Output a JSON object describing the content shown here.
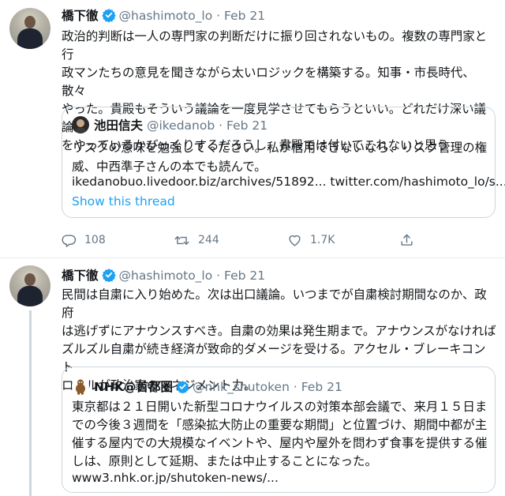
{
  "tweets": [
    {
      "name": "橋下徹",
      "handle": "@hashimoto_lo",
      "dot": "·",
      "date": "Feb 21",
      "lines": [
        "政治的判断は一人の専門家の判断だけに振り回されないもの。複数の専門家と行",
        "政マンたちの意見を聞きながら太いロジックを構築する。知事・市長時代、散々",
        "やった。貴殿もそういう議論を一度見学させてもらうといい。どれだけ深い議論",
        "をやっているかびっくりするだろうし、貴殿では付いてこれないと思う"
      ],
      "quote": {
        "name": "池田信夫",
        "handle": "@ikedanob",
        "dot": "·",
        "date": "Feb 21",
        "lines": [
          "リスクの意味を勉強してください。私が信用できないなら、リスク管理の権",
          "威、中西準子さんの本でも読んで。"
        ],
        "link": "ikedanobuo.livedoor.biz/archives/51892... twitter.com/hashimoto_lo/s...",
        "show_thread": "Show this thread"
      },
      "actions": {
        "replies": "108",
        "retweets": "244",
        "likes": "1.7K"
      }
    },
    {
      "name": "橋下徹",
      "handle": "@hashimoto_lo",
      "dot": "·",
      "date": "Feb 21",
      "lines": [
        "民間は自粛に入り始めた。次は出口議論。いつまでが自粛検討期間なのか、政府",
        "は逃げずにアナウンスすべき。自粛の効果は発生期まで。アナウンスがなければ",
        "ズルズル自粛が続き経済が致命的ダメージを受ける。アクセル・ブレーキコント",
        "ロールが政治家のマネジメント力。"
      ],
      "quote": {
        "name": "NHK@首都圏",
        "handle": "@nhk_shutoken",
        "dot": "·",
        "date": "Feb 21",
        "lines": [
          "東京都は２１日開いた新型コロナウイルスの対策本部会議で、来月１５日ま",
          "での今後３週間を「感染拡大防止の重要な期間」と位置づけ、期間中都が主",
          "催する屋内での大規模なイベントや、屋内や屋外を問わず食事を提供する催",
          "しは、原則として延期、または中止することになった。"
        ],
        "link": "www3.nhk.or.jp/shutoken-news/..."
      }
    }
  ],
  "colors": {
    "accent": "#1da1f2",
    "secondary_text": "#657786",
    "border": "#ccd6dd"
  },
  "icons": [
    "verified-badge-icon",
    "reply-icon",
    "retweet-icon",
    "like-icon",
    "share-icon"
  ]
}
